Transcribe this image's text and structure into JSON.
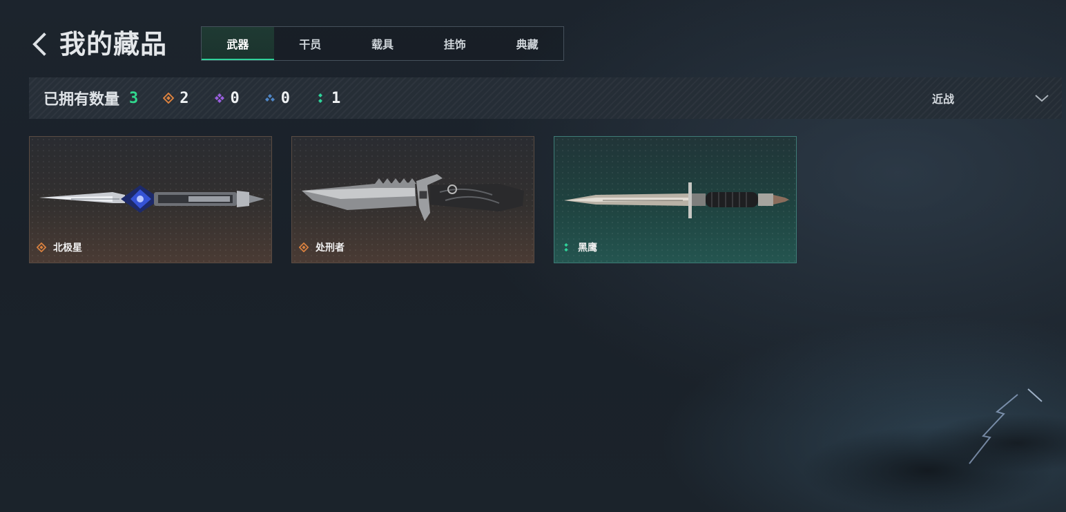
{
  "header": {
    "title": "我的藏品",
    "tabs": [
      {
        "label": "武器",
        "active": true
      },
      {
        "label": "干员",
        "active": false
      },
      {
        "label": "载具",
        "active": false
      },
      {
        "label": "挂饰",
        "active": false
      },
      {
        "label": "典藏",
        "active": false
      }
    ]
  },
  "stats": {
    "owned_label": "已拥有数量",
    "owned_count": "3",
    "rarities": [
      {
        "icon": "orange-diamond-icon",
        "color": "#d9813f",
        "count": "2"
      },
      {
        "icon": "purple-diamond-icon",
        "color": "#9a5fe0",
        "count": "0"
      },
      {
        "icon": "blue-diamond-icon",
        "color": "#4f86c6",
        "count": "0"
      },
      {
        "icon": "green-dots-icon",
        "color": "#2fd39a",
        "count": "1"
      }
    ],
    "filter": {
      "selected": "近战"
    }
  },
  "items": [
    {
      "name": "北极星",
      "rarity_color": "#d9813f",
      "weapon": "dagger-image"
    },
    {
      "name": "处刑者",
      "rarity_color": "#d9813f",
      "weapon": "serrated-knife-image"
    },
    {
      "name": "黑鹰",
      "rarity_color": "#2fd39a",
      "weapon": "bayonet-image"
    }
  ],
  "colors": {
    "accent": "#2fd39a",
    "owned_count": "#31d88e"
  }
}
